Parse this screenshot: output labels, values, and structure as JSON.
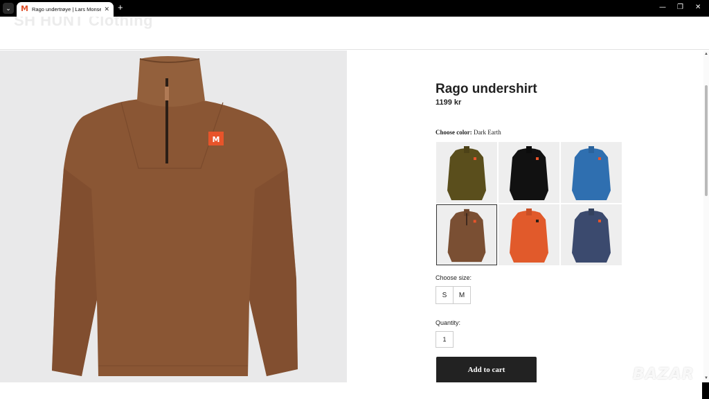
{
  "browser": {
    "tab_title": "Rago undertrøye | Lars Monsen",
    "new_tab_icon": "+",
    "close_icon": "✕",
    "minimize_icon": "—",
    "restore_icon": "❐",
    "window_close_icon": "✕",
    "menu_icon": "⌄"
  },
  "header": {
    "logo_text": "SH HUNT Clothing"
  },
  "product": {
    "title": "Rago undershirt",
    "price": "1199 kr",
    "color_label": "Choose color:",
    "color_value": "Dark Earth",
    "swatches": [
      {
        "name": "olive",
        "color": "#5a4e1c"
      },
      {
        "name": "black",
        "color": "#111111"
      },
      {
        "name": "blue",
        "color": "#2f6fb0"
      },
      {
        "name": "dark-earth",
        "color": "#7a4f33",
        "selected": true
      },
      {
        "name": "orange",
        "color": "#e15a2b"
      },
      {
        "name": "navy",
        "color": "#3b4a6e"
      }
    ],
    "size_label": "Choose size:",
    "sizes": [
      "S",
      "M"
    ],
    "quantity_label": "Quantity:",
    "quantity": "1",
    "add_to_cart": "Add to cart"
  },
  "colors": {
    "hero_shirt": "#8a5634",
    "accent": "#e8542a",
    "button": "#222222"
  },
  "watermark": "BAZAR"
}
